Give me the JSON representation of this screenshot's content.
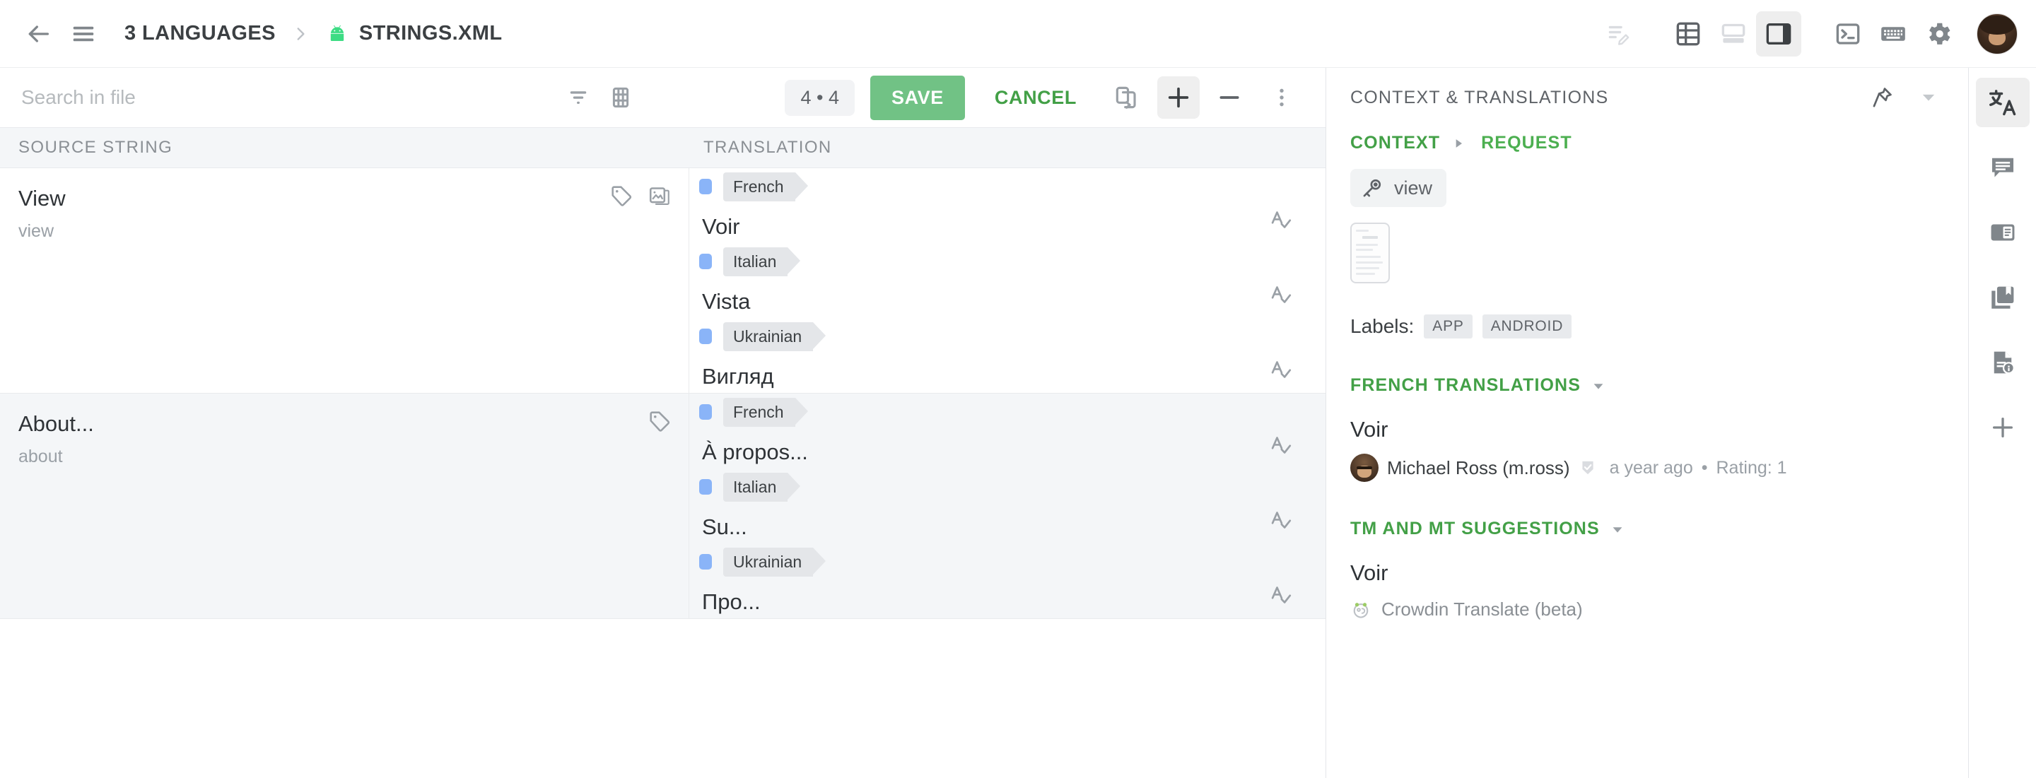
{
  "topbar": {
    "back_icon": "arrow-left-icon",
    "menu_icon": "hamburger-menu-icon",
    "breadcrumb": {
      "languages": "3 Languages",
      "separator": "chevron-right-icon",
      "file": "strings.xml",
      "file_icon": "android-robot-icon"
    },
    "actions": [
      {
        "name": "edit-list-icon",
        "label": "Edit list",
        "selected": false,
        "disabled": true
      },
      {
        "name": "table-view-icon",
        "label": "Table view",
        "selected": false
      },
      {
        "name": "bottom-panel-view-icon",
        "label": "Bottom panel view",
        "selected": false,
        "disabled": true
      },
      {
        "name": "side-panel-view-icon",
        "label": "Side panel view",
        "selected": true
      },
      {
        "name": "terminal-icon",
        "label": "Terminal",
        "selected": false
      },
      {
        "name": "keyboard-icon",
        "label": "Keyboard shortcuts",
        "selected": false
      },
      {
        "name": "gear-icon",
        "label": "Settings",
        "selected": false
      }
    ],
    "avatar": "user-avatar"
  },
  "editor_toolbar": {
    "search_placeholder": "Search in file",
    "search_value": "",
    "filter_icon": "filter-icon",
    "grid_icon": "grid-icon",
    "counter": "4 • 4",
    "save_label": "Save",
    "cancel_label": "Cancel",
    "copy_icon": "copy-to-all-icon",
    "plus_icon": "plus-icon",
    "minus_icon": "minus-icon",
    "more_icon": "more-vertical-icon"
  },
  "columns": {
    "source": "Source string",
    "translation": "Translation"
  },
  "strings": [
    {
      "source": "View",
      "key": "view",
      "active": true,
      "icons": [
        "tag-icon",
        "screenshot-icon"
      ],
      "translations": [
        {
          "language": "French",
          "text": "Voir",
          "spell_icon": "spellcheck-icon"
        },
        {
          "language": "Italian",
          "text": "Vista",
          "spell_icon": "spellcheck-icon"
        },
        {
          "language": "Ukrainian",
          "text": "Вигляд",
          "spell_icon": "spellcheck-icon"
        }
      ]
    },
    {
      "source": "About...",
      "key": "about",
      "active": false,
      "icons": [
        "tag-icon"
      ],
      "translations": [
        {
          "language": "French",
          "text": "À propos...",
          "spell_icon": "spellcheck-icon"
        },
        {
          "language": "Italian",
          "text": "Su...",
          "spell_icon": "spellcheck-icon"
        },
        {
          "language": "Ukrainian",
          "text": "Про...",
          "spell_icon": "spellcheck-icon"
        }
      ]
    }
  ],
  "right_panel": {
    "title": "Context & Translations",
    "pin_icon": "pin-icon",
    "collapse_icon": "chevron-down-icon",
    "tabs": [
      {
        "label": "Context",
        "active": true
      },
      {
        "label": "Request",
        "active": false
      }
    ],
    "tab_separator": "caret-right-icon",
    "string_key": "view",
    "key_icon": "key-icon",
    "screenshot_thumb": "screenshot-thumbnail",
    "labels_title": "Labels:",
    "labels": [
      "App",
      "Android"
    ],
    "translations_section": {
      "title": "French translations",
      "caret": "caret-down-icon",
      "entry_text": "Voir",
      "author": "Michael Ross (m.ross)",
      "approved_icon": "approved-check-icon",
      "time": "a year ago",
      "separator": "•",
      "rating": "Rating: 1"
    },
    "suggestions_section": {
      "title": "TM and MT suggestions",
      "caret": "caret-down-icon",
      "entry_text": "Voir",
      "engine_icon": "crowdin-translate-icon",
      "engine": "Crowdin Translate (beta)"
    }
  },
  "rail": [
    {
      "name": "translate-icon",
      "label": "Translations",
      "selected": true
    },
    {
      "name": "comment-icon",
      "label": "Comments",
      "selected": false
    },
    {
      "name": "terms-icon",
      "label": "Terms",
      "selected": false
    },
    {
      "name": "glossary-icon",
      "label": "Glossary",
      "selected": false
    },
    {
      "name": "file-info-icon",
      "label": "File info",
      "selected": false
    },
    {
      "name": "add-panel-icon",
      "label": "Add panel",
      "selected": false
    }
  ],
  "colors": {
    "accent_green": "#43a047",
    "save_green": "#71c285",
    "lang_dot_blue": "#8ab4f8",
    "android_green": "#3ddc84",
    "row_active_bg": "#f4f6f8"
  }
}
